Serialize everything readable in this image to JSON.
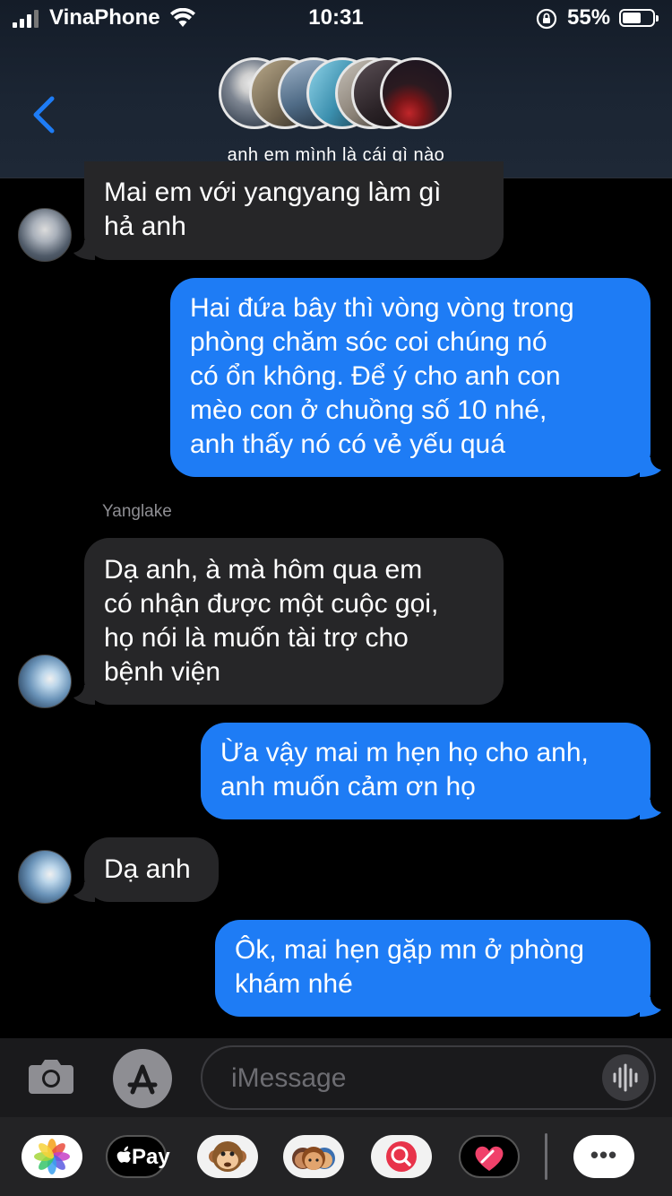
{
  "status_bar": {
    "carrier": "VinaPhone",
    "time": "10:31",
    "battery": "55%"
  },
  "header": {
    "group_name": "anh em mình là cái gì nào"
  },
  "messages": [
    {
      "direction": "incoming",
      "text": "Mai em với yangyang làm gì\nhả anh"
    },
    {
      "direction": "outgoing",
      "text": "Hai đứa bây thì vòng vòng trong\nphòng chăm sóc coi chúng nó\ncó ổn không. Để ý cho anh con\nmèo con ở chuồng số 10 nhé,\nanh thấy nó có vẻ yếu quá"
    },
    {
      "direction": "incoming",
      "sender": "Yanglake",
      "text": "Dạ anh, à mà hôm qua em\ncó nhận được một cuộc gọi,\nhọ nói là muốn tài trợ cho\nbệnh viện"
    },
    {
      "direction": "outgoing",
      "text": "Ừa vậy mai m hẹn họ cho anh,\nanh muốn cảm ơn họ"
    },
    {
      "direction": "incoming",
      "text": "Dạ anh"
    },
    {
      "direction": "outgoing",
      "text": "Ôk, mai hẹn gặp mn ở phòng\nkhám nhé"
    }
  ],
  "input": {
    "placeholder": "iMessage"
  },
  "app_drawer": {
    "apple_pay_label": "Pay",
    "more_label": "•••"
  },
  "colors": {
    "outgoing_bubble": "#1e7cf5",
    "incoming_bubble": "#262628",
    "accent": "#1e7cf5"
  },
  "icons": [
    "back-chevron-icon",
    "camera-icon",
    "app-store-icon",
    "audio-waveform-icon",
    "photos-icon",
    "apple-pay-icon",
    "monkey-animoji-icon",
    "memoji-icon",
    "image-search-icon",
    "digital-touch-heart-icon",
    "more-icon"
  ]
}
